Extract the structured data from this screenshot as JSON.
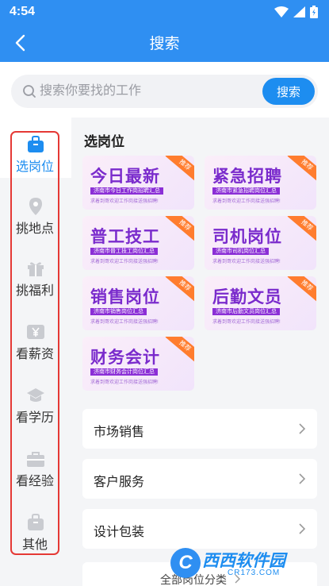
{
  "status_bar": {
    "time": "4:54",
    "icons": [
      "wifi-icon",
      "signal-icon",
      "battery-icon"
    ]
  },
  "nav": {
    "title": "搜索",
    "back_icon": "back-arrow-icon"
  },
  "search": {
    "placeholder": "搜索你要找的工作",
    "button_label": "搜索"
  },
  "sidebar": {
    "items": [
      {
        "label": "选岗位",
        "icon": "briefcase-icon",
        "active": true
      },
      {
        "label": "挑地点",
        "icon": "location-pin-icon",
        "active": false
      },
      {
        "label": "挑福利",
        "icon": "gift-icon",
        "active": false
      },
      {
        "label": "看薪资",
        "icon": "yen-icon",
        "active": false
      },
      {
        "label": "看学历",
        "icon": "graduation-cap-icon",
        "active": false
      },
      {
        "label": "看经验",
        "icon": "toolbox-icon",
        "active": false
      },
      {
        "label": "其他",
        "icon": "bag-icon",
        "active": false
      }
    ]
  },
  "main": {
    "section_title": "选岗位",
    "cards": [
      {
        "title": "今日最新",
        "bar": "济南市今日工作岗招聘汇总",
        "sub": "求着到哥欢迎工作岗接送强招聘!",
        "badge": "推荐"
      },
      {
        "title": "紧急招聘",
        "bar": "济南市紧急招聘岗位汇总",
        "sub": "求着到哥欢迎工作岗接送强招聘!",
        "badge": "推荐"
      },
      {
        "title": "普工技工",
        "bar": "济南市普工技工岗位汇总",
        "sub": "求着到哥欢迎工作岗接送强招聘!",
        "badge": "推荐"
      },
      {
        "title": "司机岗位",
        "bar": "济南市司机岗位汇总",
        "sub": "求着到哥欢迎工作岗接送强招聘!",
        "badge": "推荐"
      },
      {
        "title": "销售岗位",
        "bar": "济南市销售岗位汇总",
        "sub": "求着到哥欢迎工作岗接送强招聘!",
        "badge": "推荐"
      },
      {
        "title": "后勤文员",
        "bar": "济南市后勤文员岗位汇总",
        "sub": "求着到哥欢迎工作岗接送强招聘!",
        "badge": "推荐"
      },
      {
        "title": "财务会计",
        "bar": "济南市财务会计岗位汇总",
        "sub": "求着到哥欢迎工作岗接送强招聘!",
        "badge": "推荐"
      }
    ],
    "list": [
      {
        "label": "市场销售"
      },
      {
        "label": "客户服务"
      },
      {
        "label": "设计包装"
      }
    ],
    "all_categories": "全部岗位分类"
  },
  "watermark": {
    "logo": "C",
    "name": "西西软件园",
    "url": "CR173.COM"
  },
  "colors": {
    "primary": "#2f8ff2",
    "accent_orange": "#ff7d2e",
    "card_purple": "#7a2bcc",
    "outline_red": "#e53935"
  }
}
